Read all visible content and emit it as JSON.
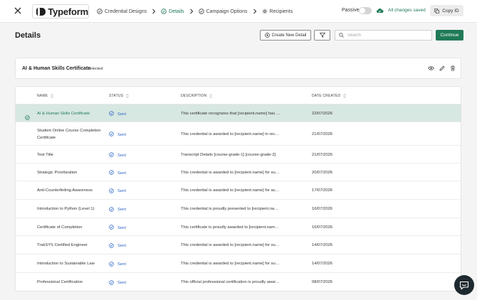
{
  "topbar": {
    "logo_text": "Typeform",
    "steps": [
      {
        "label": "Credential Designs",
        "icon": "check-circle-icon",
        "active": false
      },
      {
        "label": "Details",
        "icon": "check-circle-icon",
        "active": true
      },
      {
        "label": "Campaign Options",
        "icon": "check-circle-icon",
        "active": false
      },
      {
        "label": "Recipients",
        "icon": "gear-icon",
        "active": false
      }
    ],
    "passive_label": "Passive",
    "saved_label": "All changes saved",
    "copy_label": "Copy ID"
  },
  "header": {
    "title": "Details",
    "create_label": "Create New Detail",
    "search_placeholder": "Search",
    "continue_label": "Continue"
  },
  "selected": {
    "title": "AI & Human Skills Certificate",
    "badge": "Selected"
  },
  "table": {
    "columns": [
      "NAME",
      "STATUS",
      "DESCRIPTION",
      "DATE CREATED"
    ],
    "rows": [
      {
        "name": "AI & Human Skills Certificate",
        "status": "Sent",
        "description": "This certificate recognizes that [recipient.name] has s...",
        "date": "22/07/2026",
        "selected": true
      },
      {
        "name": "Student Online Course Completion Certificate",
        "status": "Sent",
        "description": "This credential is awarded to [recipient.name] in recog...",
        "date": "21/07/2026",
        "selected": false
      },
      {
        "name": "Test Title",
        "status": "Sent",
        "description": "Transcript Details [course-grade-1] [course-grade-2]",
        "date": "21/07/2026",
        "selected": false
      },
      {
        "name": "Strategic Prioritization",
        "status": "Sent",
        "description": "This credential is awarded to [recipient.name] for succ...",
        "date": "20/07/2026",
        "selected": false
      },
      {
        "name": "Anti-Counterfeiting Awareness",
        "status": "Sent",
        "description": "This credential is awarded to [recipient.name] for activ...",
        "date": "17/07/2026",
        "selected": false
      },
      {
        "name": "Introduction to Python (Level 1)",
        "status": "Sent",
        "description": "This credential is proudly presented to [recipient.nam...",
        "date": "16/07/2026",
        "selected": false
      },
      {
        "name": "Certificate of Completion",
        "status": "Sent",
        "description": "This certificate is proudly awarded to [recipient.name]...",
        "date": "16/07/2026",
        "selected": false
      },
      {
        "name": "TrakSYS Certified Engineer",
        "status": "Sent",
        "description": "This credential is awarded to [recipient.name] for succ...",
        "date": "14/07/2026",
        "selected": false
      },
      {
        "name": "Introduction to Sustainable Law",
        "status": "Sent",
        "description": "This credential is awarded to [recipient.name] for succ...",
        "date": "14/07/2026",
        "selected": false
      },
      {
        "name": "Professional Certification",
        "status": "Sent",
        "description": "This official professional certification is proudly award...",
        "date": "08/07/2026",
        "selected": false
      }
    ]
  },
  "colors": {
    "accent": "#1f7a57",
    "selected_row": "#d7e7e1",
    "status_blue": "#2a63c7"
  }
}
